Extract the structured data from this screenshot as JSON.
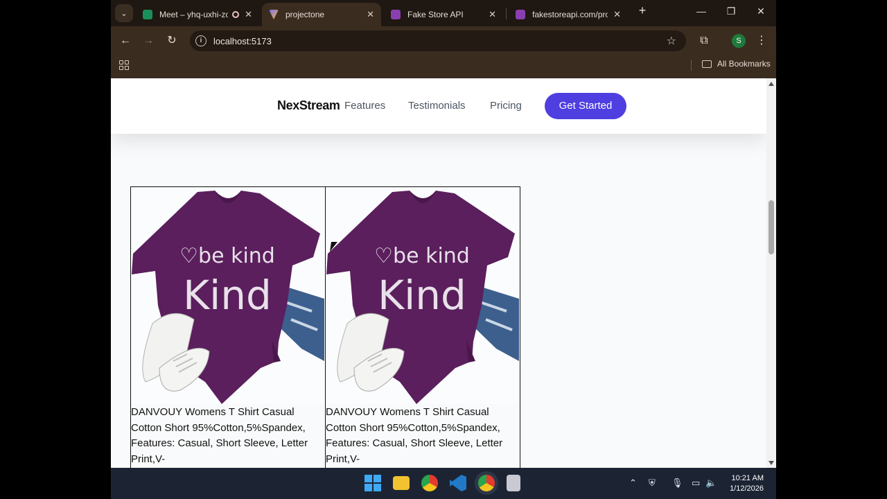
{
  "browser": {
    "tabs": [
      {
        "title": "Meet – yhq-uxhi-zc",
        "favicon_color": "#1a8f5a",
        "active": false
      },
      {
        "title": "projectone",
        "favicon_color": "#f2b92a",
        "active": true
      },
      {
        "title": "Fake Store API",
        "favicon_color": "#8a3fb0",
        "active": false
      },
      {
        "title": "fakestoreapi.com/prod",
        "favicon_color": "#8a3fb0",
        "active": false
      }
    ],
    "new_tab_label": "+",
    "address": "localhost:5173",
    "profile_initial": "S",
    "bookmarks_label": "All Bookmarks"
  },
  "site": {
    "brand": "NexStream",
    "nav": [
      "Features",
      "Testimonials",
      "Pricing"
    ],
    "cta_label": "Get Started",
    "accent_color": "#4f3ee0"
  },
  "products": [
    {
      "text": "DANVOUY Womens T Shirt Casual Cotton Short 95%Cotton,5%Spandex, Features: Casual, Short Sleeve, Letter Print,V-",
      "image_print": "♡be kind"
    },
    {
      "text": "DANVOUY Womens T Shirt Casual Cotton Short 95%Cotton,5%Spandex, Features: Casual, Short Sleeve, Letter Print,V-",
      "image_print": "♡be kind"
    }
  ],
  "taskbar": {
    "time": "10:21 AM",
    "date": "1/12/2026"
  },
  "icons": [
    "tab-dropdown-icon",
    "back-icon",
    "forward-icon",
    "reload-icon",
    "site-info-icon",
    "star-icon",
    "extensions-icon",
    "menu-icon",
    "apps-icon",
    "folder-icon",
    "windows-start-icon",
    "file-explorer-icon",
    "chrome-icon",
    "vscode-icon"
  ]
}
